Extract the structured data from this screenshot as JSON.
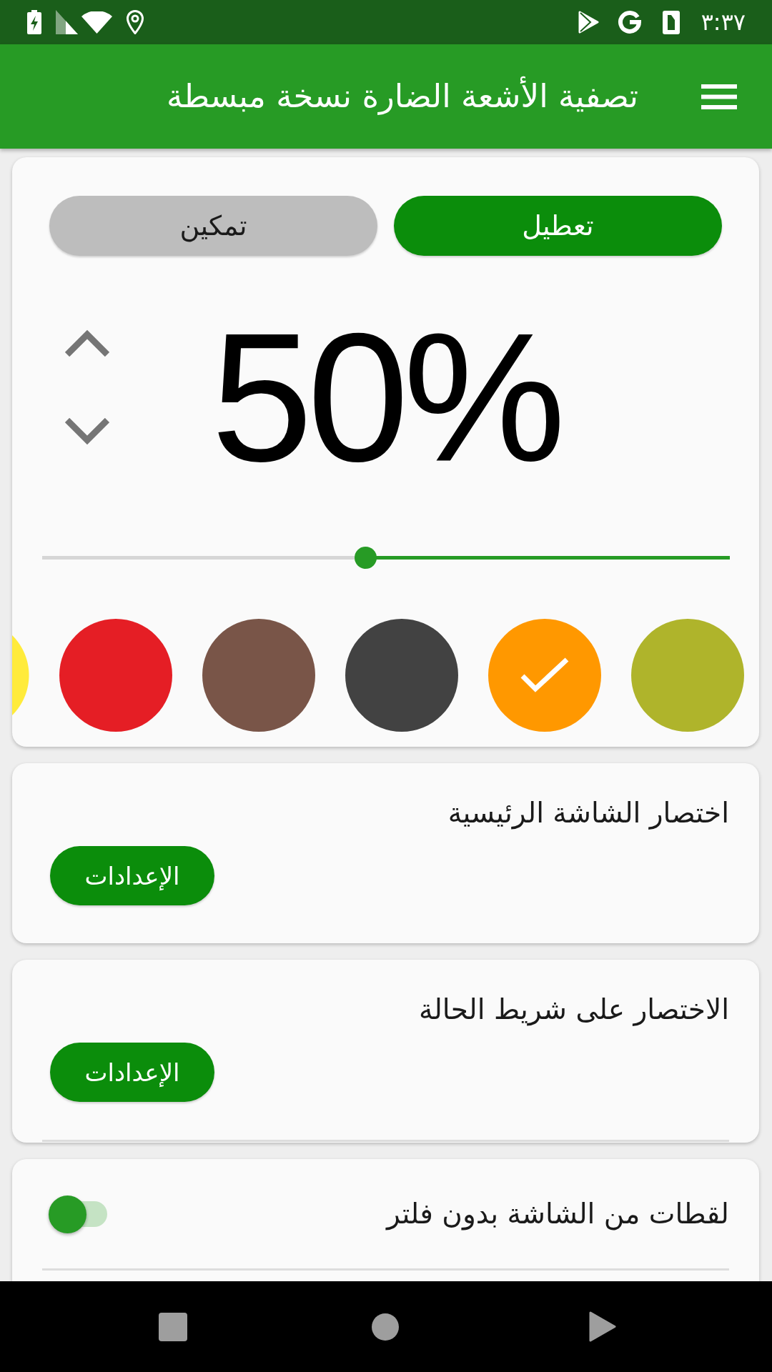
{
  "status_bar": {
    "time": "٣:٣٧"
  },
  "app_bar": {
    "title": "تصفية الأشعة الضارة نسخة مبسطة"
  },
  "filter_card": {
    "mode_buttons": [
      {
        "label": "تعطيل",
        "selected": true
      },
      {
        "label": "تمكين",
        "selected": false
      }
    ],
    "intensity": {
      "reading": "50%",
      "level": 0.53
    },
    "colors": [
      {
        "color": "#afb42b",
        "selected": false
      },
      {
        "color": "#ff9800",
        "selected": true
      },
      {
        "color": "#424242",
        "selected": false
      },
      {
        "color": "#795548",
        "selected": false
      },
      {
        "color": "#e51e25",
        "selected": false
      },
      {
        "color": "#ffeb3b",
        "selected": false
      }
    ]
  },
  "shortcut_cards": [
    {
      "title": "اختصار الشاشة الرئيسية",
      "button": "الإعدادات",
      "divider": false
    },
    {
      "title": "الاختصار على شريط الحالة",
      "button": "الإعدادات",
      "divider": true
    }
  ],
  "screenshot_option": {
    "label": "لقطات من الشاشة بدون فلتر",
    "on": true,
    "divider": true
  }
}
